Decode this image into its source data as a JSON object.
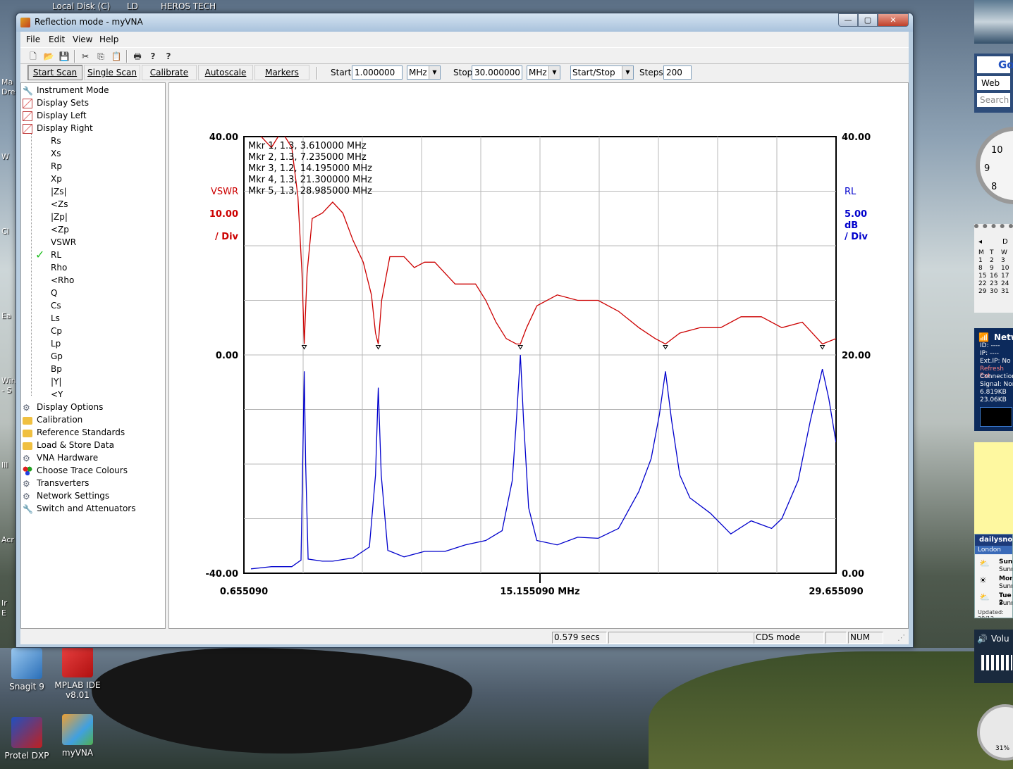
{
  "desktop": {
    "top_labels": [
      "Local Disk (C)",
      "LD",
      "HEROS TECH"
    ],
    "icons": [
      {
        "label": "Snagit 9"
      },
      {
        "label": "MPLAB IDE\nv8.01"
      },
      {
        "label": "Protel DXP"
      },
      {
        "label": "myVNA"
      }
    ],
    "left_fragments": [
      "Ma",
      "Drea",
      "W",
      "Cl",
      "Ea",
      "Win",
      "- S",
      "Ill",
      "Acr",
      "Ir",
      "E"
    ]
  },
  "gadgets": {
    "search_web": "Web",
    "search_placeholder": "Search",
    "google": "Go",
    "clock_numbers": [
      "10",
      "9",
      "8"
    ],
    "calendar": {
      "days_header": [
        "M",
        "T",
        "W"
      ],
      "rows": [
        [
          "1",
          "2",
          "3"
        ],
        [
          "8",
          "9",
          "10"
        ],
        [
          "15",
          "16",
          "17"
        ],
        [
          "22",
          "23",
          "24"
        ],
        [
          "29",
          "30",
          "31"
        ]
      ],
      "title": "D"
    },
    "network": {
      "title": "Netw",
      "lines": [
        "ID: ----",
        "IP: ----",
        "Ext.IP: No c",
        "Refresh Ext.",
        "Connection:",
        "Signal: Non",
        "6.819KB",
        "23.06KB"
      ]
    },
    "weather": {
      "title": "dailysnoo",
      "city": "London",
      "days": [
        {
          "day": "Sun",
          "desc": "Sunn"
        },
        {
          "day": "Mon",
          "desc": "Sunn"
        },
        {
          "day": "Tue 2",
          "desc": "Sunn"
        }
      ],
      "updated": "Updated: 28/12"
    },
    "volume": "Volu",
    "meter": "31%"
  },
  "window": {
    "title": "Reflection mode - myVNA",
    "buttons": {
      "minimize": "—",
      "maximize": "▢",
      "close": "✕"
    },
    "menu": [
      "File",
      "Edit",
      "View",
      "Help"
    ],
    "toolbar_icons": [
      "new-file-icon",
      "open-folder-icon",
      "save-disk-icon",
      "cut-scissors-icon",
      "copy-icon",
      "paste-icon",
      "print-icon",
      "help-icon",
      "context-help-icon"
    ],
    "toolbar_glyphs": [
      "🗋",
      "📂",
      "💾",
      "✂",
      "⎘",
      "📋",
      "🖶",
      "?",
      "?"
    ],
    "actions": {
      "start_scan": "Start Scan",
      "single_scan": "Single Scan",
      "calibrate": "Calibrate",
      "autoscale": "Autoscale",
      "markers": "Markers"
    },
    "scan": {
      "start_label": "Start",
      "start_value": "1.000000",
      "start_unit": "MHz",
      "stop_label": "Stop",
      "stop_value": "30.000000",
      "stop_unit": "MHz",
      "mode": "Start/Stop",
      "steps_label": "Steps",
      "steps_value": "200"
    },
    "tree": {
      "top": [
        "Instrument Mode",
        "Display Sets",
        "Display Left",
        "Display Right"
      ],
      "sub": [
        "Rs",
        "Xs",
        "Rp",
        "Xp",
        "|Zs|",
        "<Zs",
        "|Zp|",
        "<Zp",
        "VSWR",
        "RL",
        "Rho",
        "<Rho",
        "Q",
        "Cs",
        "Ls",
        "Cp",
        "Lp",
        "Gp",
        "Bp",
        "|Y|",
        "<Y"
      ],
      "checked": "RL",
      "bottom": [
        "Display Options",
        "Calibration",
        "Reference Standards",
        "Load & Store Data",
        "VNA Hardware",
        "Choose Trace Colours",
        "Transverters",
        "Network Settings",
        "Switch and Attenuators"
      ]
    },
    "status": {
      "time": "0.579 secs",
      "mode": "CDS mode",
      "num": "NUM"
    }
  },
  "chart_data": {
    "type": "line",
    "x_unit": "MHz",
    "xlim": [
      0.65509,
      29.65509
    ],
    "x_tick_labels": [
      "0.655090",
      "15.155090 MHz",
      "29.655090"
    ],
    "left_axis": {
      "label": "VSWR",
      "scale": "10.00",
      "div": "/ Div",
      "range": [
        -40,
        40
      ],
      "tick_labels": [
        "40.00",
        "0.00",
        "-40.00"
      ],
      "color": "#cc0000"
    },
    "right_axis": {
      "label": "RL",
      "scale": "5.00",
      "unit": "dB",
      "div": "/ Div",
      "range": [
        0,
        40
      ],
      "tick_labels": [
        "40.00",
        "20.00",
        "0.00"
      ],
      "color": "#0000cc"
    },
    "markers_text": [
      "Mkr 1, 1.3, 3.610000 MHz",
      "Mkr 2, 1.3, 7.235000 MHz",
      "Mkr 3, 1.2, 14.195000 MHz",
      "Mkr 4, 1.3, 21.300000 MHz",
      "Mkr 5, 1.3, 28.985000 MHz"
    ],
    "marker_freqs": [
      3.61,
      7.235,
      14.195,
      21.3,
      28.985
    ],
    "grid": true,
    "series": [
      {
        "axis": "left",
        "color": "#cc0000",
        "x": [
          1.0,
          1.5,
          2.0,
          2.5,
          3.0,
          3.3,
          3.5,
          3.61,
          3.75,
          4.0,
          4.5,
          5.0,
          5.5,
          6.0,
          6.5,
          6.9,
          7.1,
          7.235,
          7.4,
          7.8,
          8.5,
          9.0,
          9.5,
          10.0,
          11.0,
          12.0,
          12.5,
          13.0,
          13.5,
          14.0,
          14.195,
          14.5,
          15.0,
          16.0,
          17.0,
          18.0,
          19.0,
          20.0,
          20.8,
          21.3,
          22.0,
          23.0,
          24.0,
          25.0,
          26.0,
          27.0,
          28.0,
          28.985,
          29.65
        ],
        "y": [
          60,
          40,
          38,
          41,
          38,
          29,
          15,
          2,
          15,
          25,
          26,
          28,
          26,
          21,
          17,
          11,
          4,
          2,
          10,
          18,
          18,
          16,
          17,
          17,
          13,
          13,
          10,
          6,
          3,
          2,
          2,
          5,
          9,
          11,
          10,
          10,
          8,
          5,
          3,
          2,
          4,
          5,
          5,
          7,
          7,
          5,
          6,
          2,
          3
        ]
      },
      {
        "axis": "right",
        "color": "#0000cc",
        "x": [
          1.0,
          2.0,
          3.0,
          3.45,
          3.55,
          3.61,
          3.68,
          3.8,
          4.5,
          5.0,
          6.0,
          6.8,
          7.1,
          7.235,
          7.38,
          7.7,
          8.5,
          9.5,
          10.5,
          11.5,
          12.5,
          13.3,
          13.8,
          14.0,
          14.195,
          14.35,
          14.6,
          15.0,
          16.0,
          17.0,
          18.0,
          19.0,
          20.0,
          20.6,
          21.0,
          21.3,
          21.6,
          22.0,
          22.5,
          23.5,
          24.5,
          25.5,
          26.5,
          27.0,
          27.8,
          28.4,
          28.985,
          29.3,
          29.65
        ],
        "y": [
          0.4,
          0.6,
          0.6,
          1.2,
          12.0,
          18.5,
          10.0,
          1.3,
          1.1,
          1.1,
          1.4,
          2.4,
          9.0,
          17.0,
          9.0,
          2.1,
          1.5,
          2.0,
          2.0,
          2.6,
          3.0,
          3.9,
          8.5,
          14.0,
          20.0,
          14.0,
          6.0,
          3.0,
          2.6,
          3.3,
          3.2,
          4.1,
          7.5,
          10.5,
          14.5,
          18.5,
          14.0,
          9.0,
          6.9,
          5.5,
          3.6,
          4.8,
          4.1,
          5.0,
          8.5,
          14.0,
          18.7,
          16.0,
          12.0
        ]
      }
    ]
  }
}
